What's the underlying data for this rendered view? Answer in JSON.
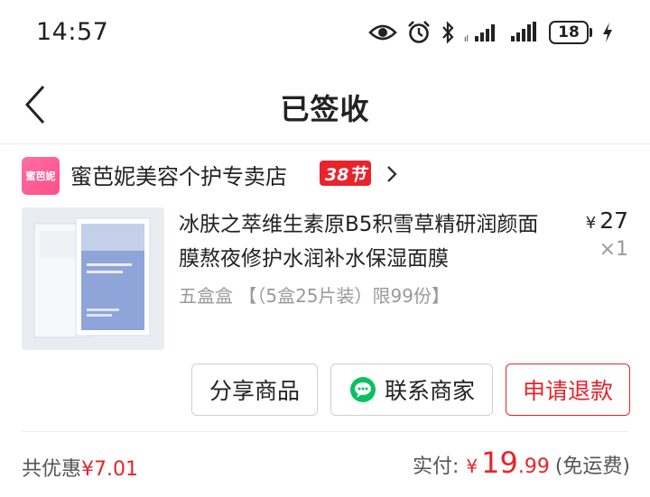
{
  "status_bar": {
    "time": "14:57",
    "battery": "18",
    "icons": [
      "eye-icon",
      "alarm-icon",
      "bluetooth-icon",
      "signal-icon",
      "signal-icon",
      "battery-icon",
      "charging-icon"
    ]
  },
  "header": {
    "title": "已签收",
    "back_icon": "chevron-left-icon"
  },
  "shop": {
    "logo_text": "蜜芭妮",
    "name": "蜜芭妮美容个护专卖店",
    "badge": "38节"
  },
  "product": {
    "title": "冰肤之萃维生素原B5积雪草精研润颜面膜熬夜修护水润补水保湿面膜",
    "spec": "五盒盒 【（5盒25片装）限99份】",
    "price_symbol": "¥",
    "price": "27",
    "quantity": "×1"
  },
  "actions": {
    "share": "分享商品",
    "contact": "联系商家",
    "refund": "申请退款"
  },
  "summary": {
    "discount_label": "共优惠",
    "discount_amount": "¥7.01",
    "paid_label": "实付:",
    "paid_symbol": "¥",
    "paid_integer": "19",
    "paid_decimal": ".99",
    "shipping_note": "(免运费)"
  },
  "colors": {
    "accent_red": "#e8232b",
    "text_dark": "#222222",
    "text_muted": "#999999",
    "wechat_green": "#07c160"
  }
}
